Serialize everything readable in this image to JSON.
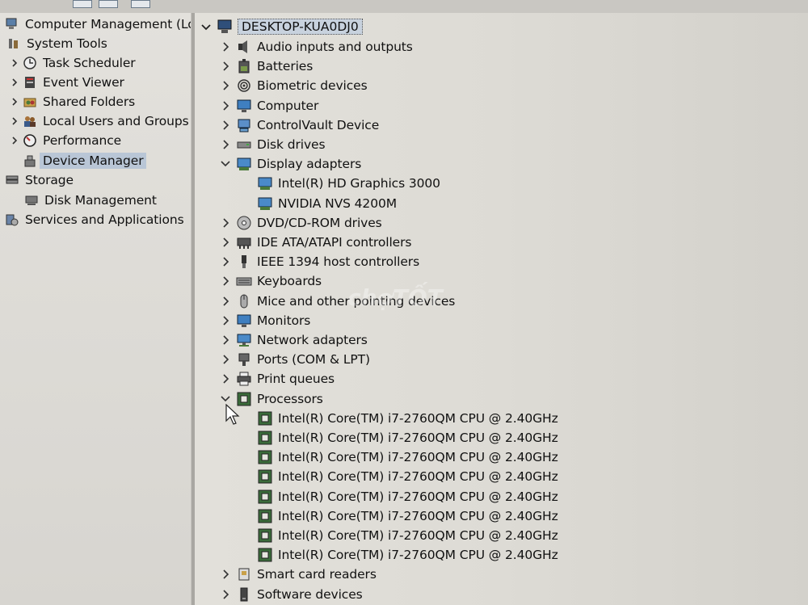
{
  "left_tree": {
    "items": [
      {
        "label": "Computer Management (Local",
        "icon": "computer-management-icon"
      },
      {
        "label": "System Tools",
        "icon": "tools-icon"
      },
      {
        "label": "Task Scheduler",
        "icon": "clock-icon"
      },
      {
        "label": "Event Viewer",
        "icon": "event-viewer-icon"
      },
      {
        "label": "Shared Folders",
        "icon": "shared-folder-icon"
      },
      {
        "label": "Local Users and Groups",
        "icon": "users-icon"
      },
      {
        "label": "Performance",
        "icon": "performance-icon"
      },
      {
        "label": "Device Manager",
        "icon": "device-manager-icon"
      },
      {
        "label": "Storage",
        "icon": "storage-icon"
      },
      {
        "label": "Disk Management",
        "icon": "disk-management-icon"
      },
      {
        "label": "Services and Applications",
        "icon": "services-icon"
      }
    ]
  },
  "device_tree": {
    "host": "DESKTOP-KUA0DJ0",
    "categories": [
      {
        "label": "Audio inputs and outputs",
        "icon": "speaker-icon"
      },
      {
        "label": "Batteries",
        "icon": "battery-icon"
      },
      {
        "label": "Biometric devices",
        "icon": "fingerprint-icon"
      },
      {
        "label": "Computer",
        "icon": "monitor-icon"
      },
      {
        "label": "ControlVault Device",
        "icon": "device-icon"
      },
      {
        "label": "Disk drives",
        "icon": "disk-drive-icon"
      },
      {
        "label": "Display adapters",
        "icon": "display-adapter-icon"
      },
      {
        "label": "DVD/CD-ROM drives",
        "icon": "dvd-icon"
      },
      {
        "label": "IDE ATA/ATAPI controllers",
        "icon": "ide-controller-icon"
      },
      {
        "label": "IEEE 1394 host controllers",
        "icon": "ieee1394-icon"
      },
      {
        "label": "Keyboards",
        "icon": "keyboard-icon"
      },
      {
        "label": "Mice and other pointing devices",
        "icon": "mouse-icon"
      },
      {
        "label": "Monitors",
        "icon": "monitor-icon"
      },
      {
        "label": "Network adapters",
        "icon": "network-adapter-icon"
      },
      {
        "label": "Ports (COM & LPT)",
        "icon": "port-icon"
      },
      {
        "label": "Print queues",
        "icon": "printer-icon"
      },
      {
        "label": "Processors",
        "icon": "processor-icon"
      },
      {
        "label": "Smart card readers",
        "icon": "smart-card-icon"
      },
      {
        "label": "Software devices",
        "icon": "software-device-icon"
      }
    ],
    "display_adapters": [
      "Intel(R) HD Graphics 3000",
      "NVIDIA NVS 4200M"
    ],
    "processors": [
      "Intel(R) Core(TM) i7-2760QM CPU @ 2.40GHz",
      "Intel(R) Core(TM) i7-2760QM CPU @ 2.40GHz",
      "Intel(R) Core(TM) i7-2760QM CPU @ 2.40GHz",
      "Intel(R) Core(TM) i7-2760QM CPU @ 2.40GHz",
      "Intel(R) Core(TM) i7-2760QM CPU @ 2.40GHz",
      "Intel(R) Core(TM) i7-2760QM CPU @ 2.40GHz",
      "Intel(R) Core(TM) i7-2760QM CPU @ 2.40GHz",
      "Intel(R) Core(TM) i7-2760QM CPU @ 2.40GHz"
    ]
  },
  "watermark": "chợTỐT",
  "colors": {
    "selection": "#b9c6d6",
    "chevron": "#333333",
    "processor_icon": "#3a6b3a"
  }
}
